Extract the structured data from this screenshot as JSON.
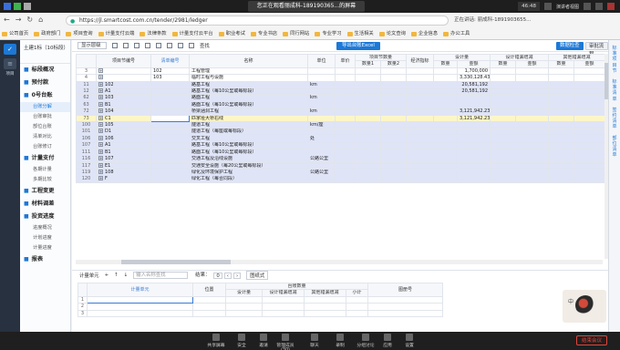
{
  "os": {
    "center_title": "您正在观看丽成科-189190365...的屏幕",
    "time": "46:48",
    "right_label": "演讲者视图"
  },
  "browser": {
    "url": "https://jl.smartcost.com.cn/tender/2981/ledger",
    "meeting_status": "正在讲话: 丽成科-1891903655...",
    "bookmarks": [
      "公司首页",
      "政府部门",
      "项目查询",
      "计量支付云端",
      "法律条款",
      "计量支付云平台",
      "职业考试",
      "专业书店",
      "同行网站",
      "专业学习",
      "生活相关",
      "论文查询",
      "企业信息",
      "办公工具"
    ]
  },
  "leftnav": {
    "items": [
      {
        "icon": "check-icon"
      },
      {
        "icon": "list-icon"
      },
      {
        "icon": "grid-icon"
      }
    ],
    "label": "项目"
  },
  "sidebar": {
    "project": "土建1标（10标段）",
    "groups": [
      {
        "label": "标段概况",
        "items": []
      },
      {
        "label": "预付款",
        "items": []
      },
      {
        "label": "0号台账",
        "items": [
          "台账分解",
          "台账审批",
          "部位台账",
          "清单对比",
          "台账修订"
        ]
      },
      {
        "label": "计量支付",
        "items": [
          "各期计量",
          "多期比较"
        ]
      },
      {
        "label": "工程变更",
        "items": []
      },
      {
        "label": "材料调差",
        "items": []
      },
      {
        "label": "投资进度",
        "items": [
          "进度概况",
          "计划进度",
          "计量进度"
        ]
      },
      {
        "label": "报表",
        "items": []
      }
    ],
    "active_item": "台账分解"
  },
  "toolbar": {
    "mode": "显示层级",
    "export": "导出台账Excel",
    "btn_query": "数据检查",
    "btn_audit": "审批流程",
    "locate": "查找"
  },
  "grid": {
    "headers_top": [
      "",
      "项目节编号",
      "清单编号",
      "名称",
      "单位",
      "单价",
      "项目节数量",
      "",
      "经济指标",
      "设计量",
      "",
      "设计错漏增减",
      "",
      "其他错漏增减",
      ""
    ],
    "headers_sub": [
      "数量1",
      "数量2",
      "数量",
      "金额",
      "数量",
      "金额",
      "数量",
      "金额"
    ],
    "rows": [
      {
        "n": "3",
        "code": "",
        "qd": "102",
        "name": "工程管理",
        "unit": "",
        "dj": "",
        "amt": "1,700,000",
        "style": ""
      },
      {
        "n": "4",
        "code": "",
        "qd": "103",
        "name": "临时工程与设施",
        "unit": "",
        "dj": "",
        "amt": "3,330,128.43",
        "style": ""
      },
      {
        "n": "11",
        "code": "102",
        "qd": "",
        "name": "路基工程",
        "unit": "km",
        "dj": "",
        "amt": "20,581,192",
        "style": "blue"
      },
      {
        "n": "12",
        "code": "A1",
        "qd": "",
        "name": "路基工程（每10公里或每标段）",
        "unit": "",
        "dj": "",
        "amt": "20,581,192",
        "style": "blue"
      },
      {
        "n": "62",
        "code": "103",
        "qd": "",
        "name": "路面工程",
        "unit": "km",
        "dj": "",
        "amt": "",
        "style": "blue"
      },
      {
        "n": "63",
        "code": "B1",
        "qd": "",
        "name": "路面工程（每10公里或每标段）",
        "unit": "",
        "dj": "",
        "amt": "",
        "style": "blue"
      },
      {
        "n": "72",
        "code": "104",
        "qd": "",
        "name": "桥梁涵洞工程",
        "unit": "km",
        "dj": "",
        "amt": "3,121,942.23",
        "style": "blue"
      },
      {
        "n": "73",
        "code": "C1",
        "qd": "",
        "name": "匹家垭大桥右线",
        "unit": "",
        "dj": "",
        "amt": "3,121,942.23",
        "style": "sel"
      },
      {
        "n": "100",
        "code": "105",
        "qd": "",
        "name": "隧道工程",
        "unit": "km/座",
        "dj": "",
        "amt": "",
        "style": "blue"
      },
      {
        "n": "101",
        "code": "D1",
        "qd": "",
        "name": "隧道工程（每座或每标段）",
        "unit": "",
        "dj": "",
        "amt": "",
        "style": "blue"
      },
      {
        "n": "106",
        "code": "106",
        "qd": "",
        "name": "交叉工程",
        "unit": "处",
        "dj": "",
        "amt": "",
        "style": "blue"
      },
      {
        "n": "107",
        "code": "A1",
        "qd": "",
        "name": "路基工程（每10公里或每标段）",
        "unit": "",
        "dj": "",
        "amt": "",
        "style": "blue"
      },
      {
        "n": "111",
        "code": "B1",
        "qd": "",
        "name": "路面工程（每10公里或每标段）",
        "unit": "",
        "dj": "",
        "amt": "",
        "style": "blue"
      },
      {
        "n": "116",
        "code": "107",
        "qd": "",
        "name": "交通工程及沿线设施",
        "unit": "公路公里",
        "dj": "",
        "amt": "",
        "style": "blue"
      },
      {
        "n": "117",
        "code": "E1",
        "qd": "",
        "name": "交通安全设施（每20公里或每标段）",
        "unit": "",
        "dj": "",
        "amt": "",
        "style": "blue"
      },
      {
        "n": "119",
        "code": "108",
        "qd": "",
        "name": "绿化及环境保护工程",
        "unit": "公路公里",
        "dj": "",
        "amt": "",
        "style": "blue"
      },
      {
        "n": "120",
        "code": "F",
        "qd": "",
        "name": "绿化工程（每合同段）",
        "unit": "",
        "dj": "",
        "amt": "",
        "style": "blue"
      }
    ]
  },
  "bottom": {
    "label": "计量单元",
    "search_placeholder": "输入名称查找",
    "result_label": "结果：",
    "result_count": "0",
    "toggle": "图纸式"
  },
  "lower_grid": {
    "headers_top": [
      "",
      "计量单元",
      "位置",
      "台账数量",
      "",
      "",
      "",
      "图册号"
    ],
    "headers_sub": [
      "设计量",
      "设计错漏增减",
      "其他错漏增减",
      "小计"
    ],
    "rows": [
      "1",
      "2",
      "3"
    ]
  },
  "rightrail": [
    "标准项目节",
    "标准清单",
    "签约清单",
    "部位清单"
  ],
  "meetbar": {
    "buttons": [
      "共享屏幕",
      "安全",
      "邀请",
      "管理成员(30)",
      "聊天",
      "录制",
      "分组讨论",
      "应用",
      "设置"
    ],
    "end": "结束会议"
  },
  "avatar_card": {
    "label": "中"
  }
}
